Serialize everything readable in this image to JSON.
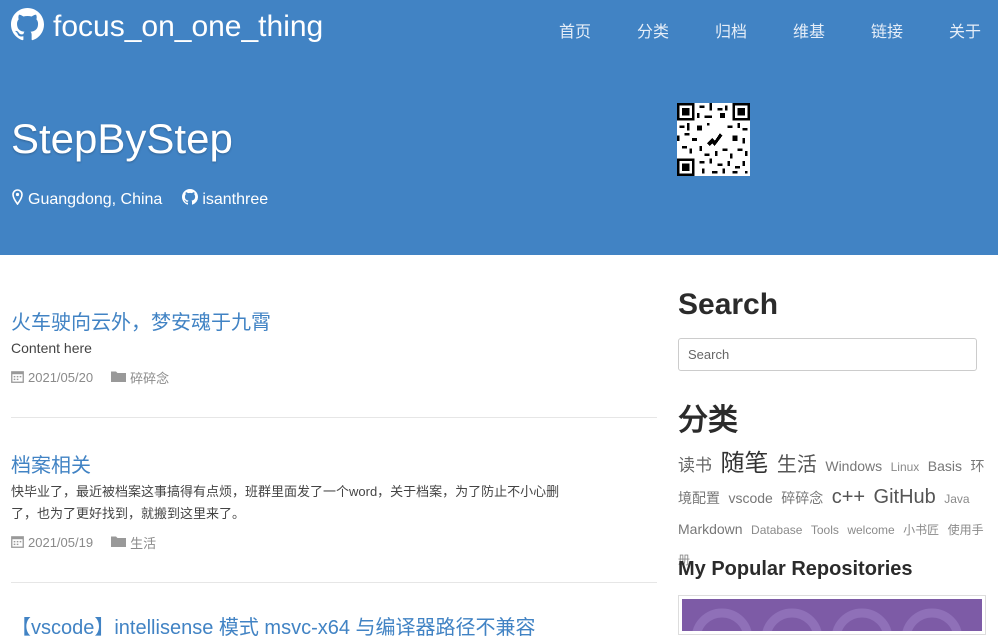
{
  "header": {
    "brand": "focus_on_one_thing",
    "nav": [
      "首页",
      "分类",
      "归档",
      "维基",
      "链接",
      "关于"
    ],
    "title": "StepByStep",
    "location": "Guangdong, China",
    "github_user": "isanthree"
  },
  "posts": [
    {
      "title": "火车驶向云外，梦安魂于九霄",
      "excerpt": "Content here",
      "date": "2021/05/20",
      "category": "碎碎念"
    },
    {
      "title": "档案相关",
      "excerpt": "快毕业了，最近被档案这事搞得有点烦，班群里面发了一个word，关于档案，为了防止不小心删了，也为了更好找到，就搬到这里来了。",
      "date": "2021/05/19",
      "category": "生活"
    },
    {
      "title": "【vscode】intellisense 模式 msvc-x64 与编译器路径不兼容"
    }
  ],
  "sidebar": {
    "search_heading": "Search",
    "search_placeholder": "Search",
    "category_heading": "分类",
    "tags": [
      {
        "label": "读书",
        "size": "l"
      },
      {
        "label": "随笔",
        "size": "xxl"
      },
      {
        "label": "生活",
        "size": "xl"
      },
      {
        "label": "Windows",
        "size": "m"
      },
      {
        "label": "Linux",
        "size": "xs"
      },
      {
        "label": "Basis",
        "size": "m"
      },
      {
        "label": "环境配置",
        "size": "m"
      },
      {
        "label": "vscode",
        "size": "m"
      },
      {
        "label": "碎碎念",
        "size": "m"
      },
      {
        "label": "c++",
        "size": "xl"
      },
      {
        "label": "GitHub",
        "size": "xl"
      },
      {
        "label": "Java",
        "size": "xs"
      },
      {
        "label": "Markdown",
        "size": "m"
      },
      {
        "label": "Database",
        "size": "xs"
      },
      {
        "label": "Tools",
        "size": "xs"
      },
      {
        "label": "welcome",
        "size": "xs"
      },
      {
        "label": "小书匠",
        "size": "xs"
      },
      {
        "label": "使用手册",
        "size": "xs"
      }
    ],
    "repos_heading": "My Popular Repositories"
  },
  "colors": {
    "header_bg": "#4183c4",
    "link": "#4183c4",
    "repo_card": "#7d5ba6"
  }
}
